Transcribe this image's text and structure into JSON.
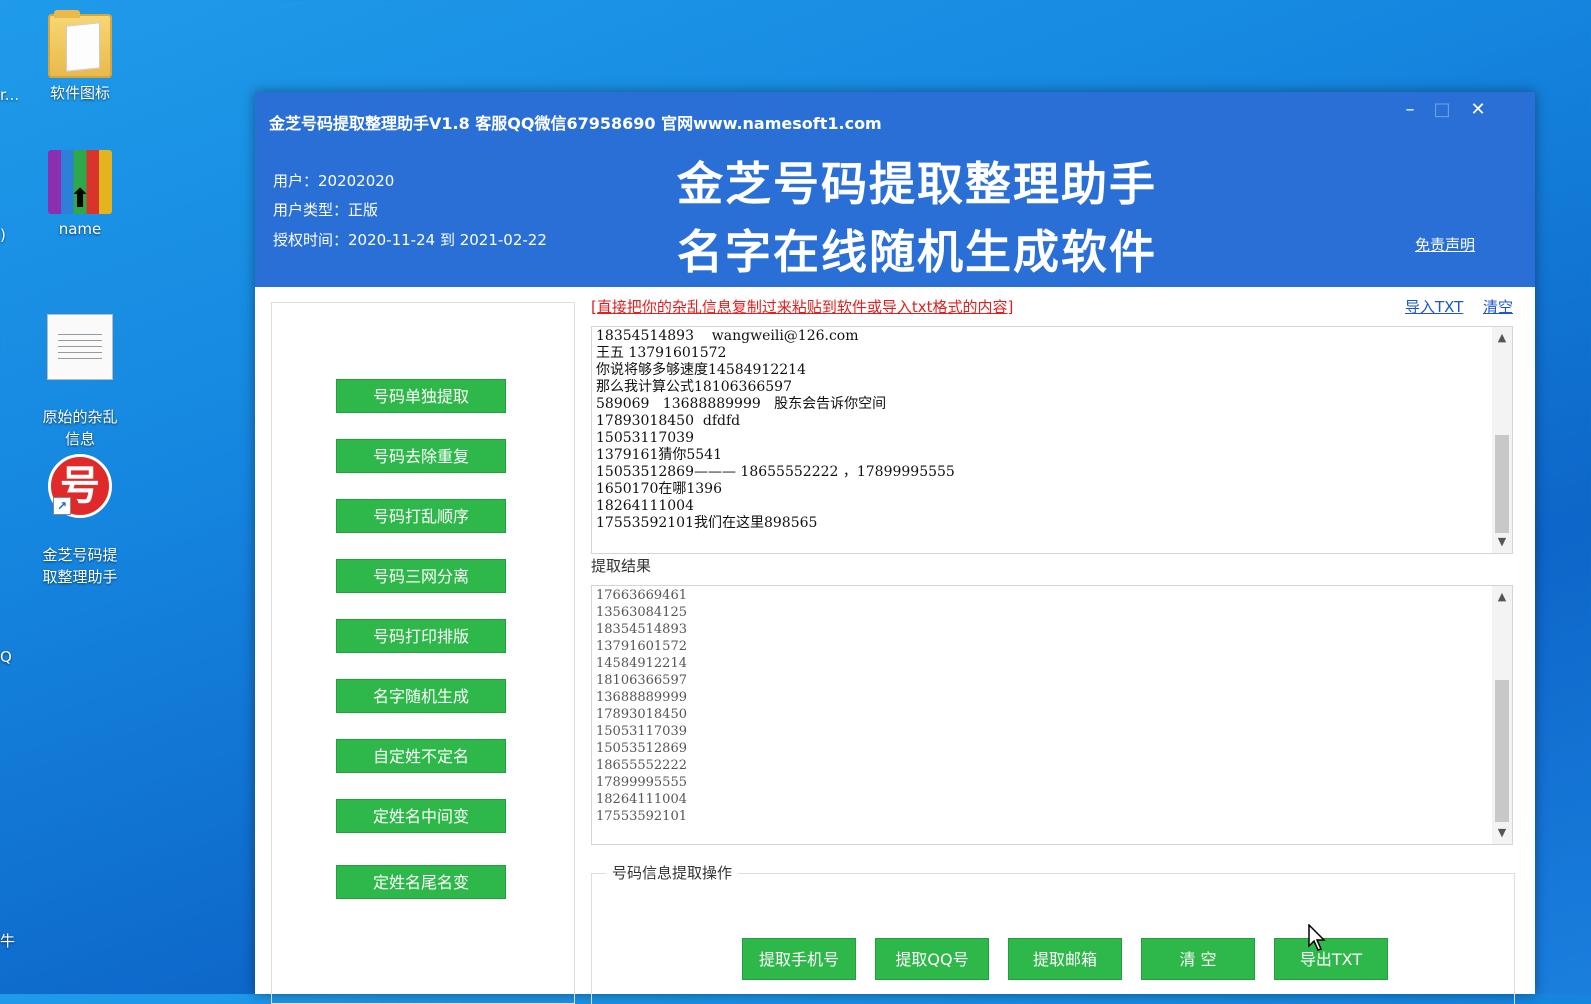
{
  "desktop": {
    "icons": [
      {
        "label": "软件图标"
      },
      {
        "label": "name"
      },
      {
        "label": "原始的杂乱\n信息"
      },
      {
        "label": "金芝号码提\n取整理助手"
      }
    ],
    "edge_labels": [
      "r...",
      ")",
      "Q",
      "牛"
    ]
  },
  "window": {
    "title": "金芝号码提取整理助手V1.8 客服QQ微信67958690 官网www.namesoft1.com",
    "controls": {
      "minimize": "–",
      "maximize": "□",
      "close": "✕"
    },
    "user": "用户：20202020",
    "user_type": "用户类型：正版",
    "license": "授权时间：2020-11-24 到 2021-02-22",
    "headline1": "金芝号码提取整理助手",
    "headline2": "名字在线随机生成软件",
    "disclaimer": "免责声明"
  },
  "sidebar": {
    "buttons": [
      "号码单独提取",
      "号码去除重复",
      "号码打乱顺序",
      "号码三网分离",
      "号码打印排版",
      "名字随机生成",
      "自定姓不定名",
      "定姓名中间变",
      "定姓名尾名变"
    ]
  },
  "input": {
    "hint": "[直接把你的杂乱信息复制过来粘贴到软件或导入txt格式的内容]",
    "import_label": "导入TXT",
    "clear_label": "清空",
    "lines": [
      "18354514893    wangweili@126.com",
      "王五 13791601572",
      "你说将够多够速度14584912214",
      "那么我计算公式18106366597",
      "589069   13688889999   股东会告诉你空间",
      "17893018450  dfdfd",
      "15053117039",
      "1379161猜你5541",
      "15053512869——— 18655552222 ，17899995555",
      "1650170在哪1396",
      "18264111004",
      "17553592101我们在这里898565"
    ]
  },
  "result": {
    "label": "提取结果",
    "lines": [
      "17663669461",
      "13563084125",
      "18354514893",
      "13791601572",
      "14584912214",
      "18106366597",
      "13688889999",
      "17893018450",
      "15053117039",
      "15053512869",
      "18655552222",
      "17899995555",
      "18264111004",
      "17553592101"
    ]
  },
  "actions": {
    "group_title": "号码信息提取操作",
    "buttons": [
      "提取手机号",
      "提取QQ号",
      "提取邮箱",
      "清 空",
      "导出TXT"
    ]
  }
}
